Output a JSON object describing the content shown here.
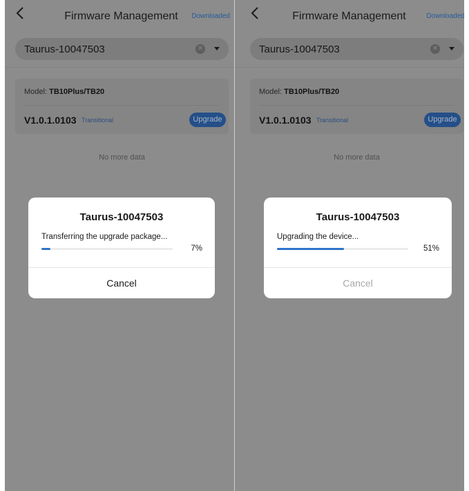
{
  "panels": [
    {
      "nav": {
        "title": "Firmware Management",
        "downloaded_label": "Downloaded"
      },
      "search": {
        "value": "Taurus-10047503"
      },
      "firmware": {
        "model_label": "Model:",
        "model_value": "TB10Plus/TB20",
        "version": "V1.0.1.0103",
        "tag": "Transitional",
        "upgrade_label": "Upgrade"
      },
      "no_more": "No more data",
      "dialog": {
        "title": "Taurus-10047503",
        "status": "Transferring the upgrade package...",
        "progress": 0.07,
        "progress_text": "7%",
        "cancel_label": "Cancel",
        "cancel_enabled": true
      }
    },
    {
      "nav": {
        "title": "Firmware Management",
        "downloaded_label": "Downloaded"
      },
      "search": {
        "value": "Taurus-10047503"
      },
      "firmware": {
        "model_label": "Model:",
        "model_value": "TB10Plus/TB20",
        "version": "V1.0.1.0103",
        "tag": "Transitional",
        "upgrade_label": "Upgrade"
      },
      "no_more": "No more data",
      "dialog": {
        "title": "Taurus-10047503",
        "status": "Upgrading the device...",
        "progress": 0.51,
        "progress_text": "51%",
        "cancel_label": "Cancel",
        "cancel_enabled": false
      }
    }
  ],
  "colors": {
    "overlay_background": "#8c8c8c",
    "accent": "#2d73c9",
    "dialog_background": "#ffffff"
  }
}
